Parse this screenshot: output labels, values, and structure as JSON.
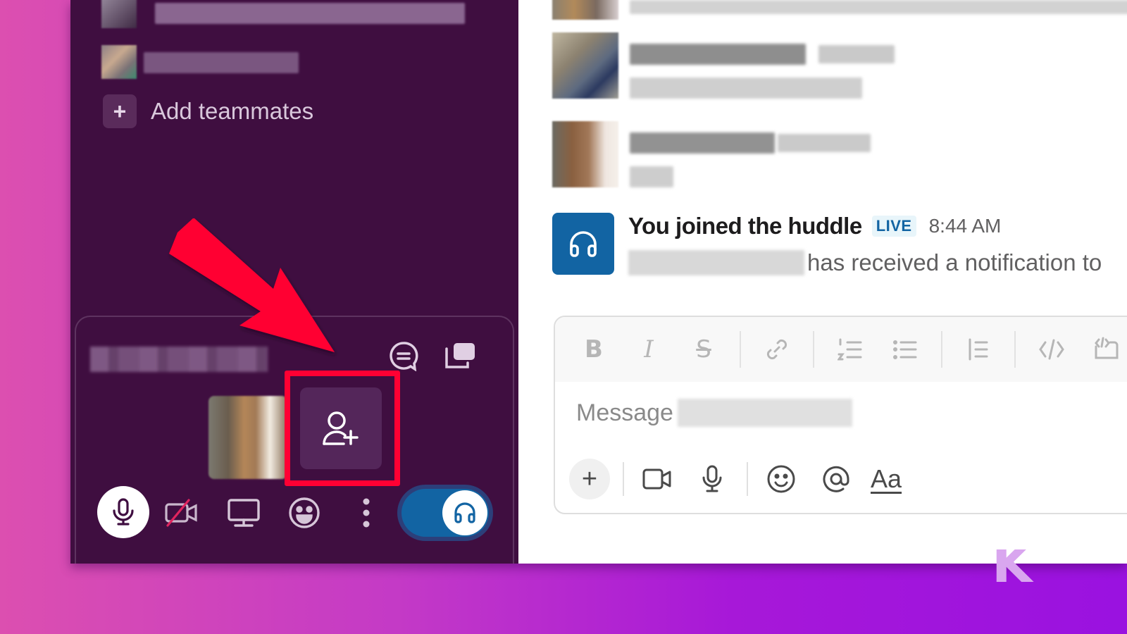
{
  "sidebar": {
    "add_teammates_label": "Add teammates",
    "add_teammates_icon": "plus-icon"
  },
  "huddle": {
    "thread_icon": "huddle-thread-icon",
    "popout_icon": "popout-window-icon",
    "add_people_icon": "add-person-icon",
    "controls": {
      "mic_icon": "microphone-icon",
      "video_icon": "video-off-icon",
      "screen_icon": "screen-share-icon",
      "reaction_icon": "emoji-reaction-icon",
      "more_icon": "more-vertical-icon",
      "headphones_icon": "headphones-icon",
      "huddle_toggle_on": true
    }
  },
  "main": {
    "huddle_message": {
      "title": "You joined the huddle",
      "badge": "LIVE",
      "time": "8:44 AM",
      "subtext": "has received a notification to"
    },
    "composer": {
      "formatting": [
        {
          "name": "bold",
          "glyph": "B"
        },
        {
          "name": "italic",
          "glyph": "I"
        },
        {
          "name": "strikethrough",
          "glyph": "S"
        },
        {
          "name": "link",
          "glyph": "link"
        },
        {
          "name": "ordered-list",
          "glyph": "ol"
        },
        {
          "name": "bulleted-list",
          "glyph": "ul"
        },
        {
          "name": "blockquote",
          "glyph": "quote"
        },
        {
          "name": "code",
          "glyph": "</>"
        },
        {
          "name": "code-block",
          "glyph": "codeblock"
        }
      ],
      "placeholder": "Message",
      "attach_label": "+",
      "format_toggle_label": "Aa"
    }
  },
  "annotation": {
    "highlight_color": "#ff0033",
    "arrow_color": "#ff0033"
  },
  "watermark": "K",
  "colors": {
    "sidebar_bg": "#3f0e40",
    "accent_blue": "#1264a3"
  }
}
